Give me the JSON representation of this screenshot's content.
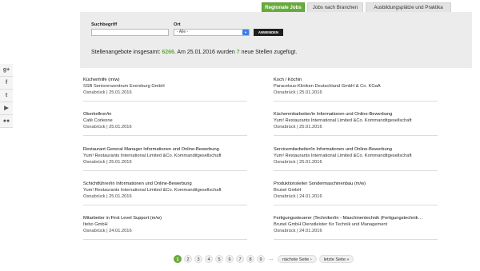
{
  "tabs": [
    "Regionale Jobs",
    "Jobs nach Branchen",
    "Ausbildungsplätze und Praktika"
  ],
  "search": {
    "label_query": "Suchbegriff",
    "label_location": "Ort",
    "location_value": "- Alle -",
    "submit_label": "ANWENDEN"
  },
  "stats": {
    "prefix": "Stellenangebote insgesamt: ",
    "total": "6266",
    "middle": ". Am 25.01.2016 wurden ",
    "new_count": "7",
    "suffix": " neue Stellen zugefügt."
  },
  "social": [
    "g+",
    "f",
    "t",
    "▶",
    "●●"
  ],
  "jobs": [
    {
      "title": "Küchenhilfe (m/w)",
      "company": "SSB Seniorenzentrum Eversburg GmbH",
      "meta": "Osnabrück | 25.01.2016"
    },
    {
      "title": "Koch / Köchin",
      "company": "Paracelsus-Kliniken Deutschland GmbH & Co. KGaA",
      "meta": "Osnabrück | 25.01.2016"
    },
    {
      "title": "Oberkellner/in",
      "company": "Café Corleone",
      "meta": "Osnabrück | 25.01.2016"
    },
    {
      "title": "Küchenmitarbeiter/in Informationen und Online-Bewerbung",
      "company": "Yum! Restaurants International Limited &Co. Kommanditgesellschaft",
      "meta": "Osnabrück | 25.01.2016"
    },
    {
      "title": "Restaurant General Manager Informationen und Online-Bewerbung",
      "company": "Yum! Restaurants International Limited &Co. Kommanditgesellschaft",
      "meta": "Osnabrück | 25.01.2016"
    },
    {
      "title": "Servicemitarbeiter/in Informationen und Online-Bewerbung",
      "company": "Yum! Restaurants International Limited &Co. Kommanditgesellschaft",
      "meta": "Osnabrück | 25.01.2016"
    },
    {
      "title": "Schichtführer/in Informationen und Online-Bewerbung",
      "company": "Yum! Restaurants International Limited &Co. Kommanditgesellschaft",
      "meta": "Osnabrück | 25.01.2016"
    },
    {
      "title": "Produktionsleiter Sondermaschinenbau (m/w)",
      "company": "Brunel GmbH",
      "meta": "Osnabrück | 24.01.2016"
    },
    {
      "title": "Mitarbeiter in First Level Support (m/w)",
      "company": "Itebo GmbH",
      "meta": "Osnabrück | 24.01.2016"
    },
    {
      "title": "Fertigungssteuerer (Techniker/in - Maschinentechnik (Fertigungstechnik…",
      "company": "Brunel GmbH Dienstleister für Technik und Management",
      "meta": "Osnabrück | 24.01.2016"
    }
  ],
  "pagination": {
    "pages": [
      "1",
      "2",
      "3",
      "4",
      "5",
      "6",
      "7",
      "8",
      "9"
    ],
    "ellipsis": "…",
    "next": "nächste Seite ›",
    "last": "letzte Seite »"
  }
}
